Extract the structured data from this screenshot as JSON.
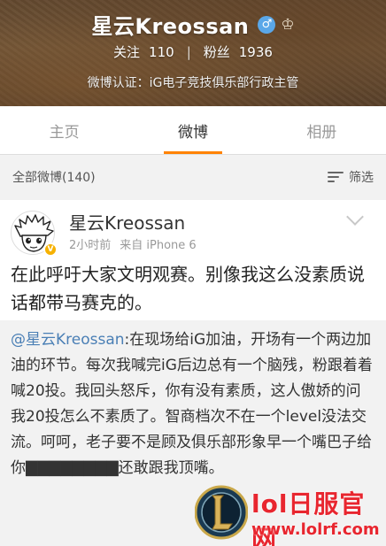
{
  "profile": {
    "name": "星云Kreossan",
    "gender_icon": "male-icon",
    "crown_icon": "crown-icon",
    "following_label": "关注",
    "following_count": "110",
    "separator": "|",
    "followers_label": "粉丝",
    "followers_count": "1936",
    "verification": "微博认证：iG电子竞技俱乐部行政主管"
  },
  "tabs": [
    {
      "label": "主页",
      "active": false
    },
    {
      "label": "微博",
      "active": true
    },
    {
      "label": "相册",
      "active": false
    }
  ],
  "filter": {
    "all_label": "全部微博(140)",
    "filter_label": "筛选"
  },
  "post": {
    "author": "星云Kreossan",
    "badge": "V",
    "time": "2小时前",
    "source": "来自 iPhone 6",
    "text": "在此呼吁大家文明观赛。别像我这么没素质说话都带马赛克的。",
    "repost_mention": "@星云Kreossan",
    "repost_text": ":在现场给iG加油，开场有一个两边加油的环节。每次我喊完iG后边总有一个脑残，粉跟着着喊20投。我回头怒斥，你有没有素质，这人傲娇的问我20投怎么不素质了。智商档次不在一个level没法交流。呵呵，老子要不是顾及俱乐部形象早一个嘴巴子给你▇▇▇▇▇▇▇▇还敢跟我顶嘴。"
  },
  "watermark": {
    "title": "lol日服官网",
    "url": "www.lolrf.com"
  },
  "colors": {
    "accent": "#ff8200",
    "mention": "#4a7fb5",
    "watermark": "#e8262f"
  }
}
